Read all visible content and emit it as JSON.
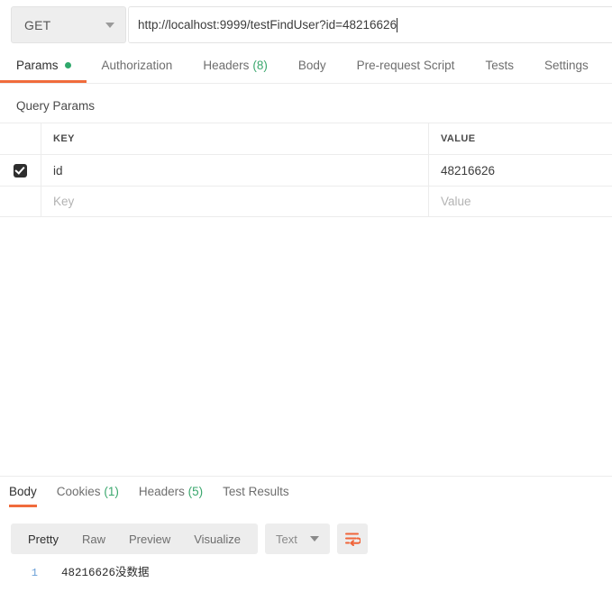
{
  "request": {
    "method": "GET",
    "url": "http://localhost:9999/testFindUser?id=48216626",
    "tabs": [
      {
        "label": "Params",
        "indicator": "dot",
        "active": true
      },
      {
        "label": "Authorization",
        "active": false
      },
      {
        "label": "Headers",
        "count": "(8)",
        "active": false
      },
      {
        "label": "Body",
        "active": false
      },
      {
        "label": "Pre-request Script",
        "active": false
      },
      {
        "label": "Tests",
        "active": false
      },
      {
        "label": "Settings",
        "active": false
      }
    ]
  },
  "query_params": {
    "section_title": "Query Params",
    "columns": {
      "key": "KEY",
      "value": "VALUE"
    },
    "rows": [
      {
        "checked": true,
        "key": "id",
        "value": "48216626"
      },
      {
        "checked": false,
        "key_placeholder": "Key",
        "value_placeholder": "Value"
      }
    ]
  },
  "response": {
    "tabs": [
      {
        "label": "Body",
        "active": true
      },
      {
        "label": "Cookies",
        "count": "(1)",
        "active": false
      },
      {
        "label": "Headers",
        "count": "(5)",
        "active": false
      },
      {
        "label": "Test Results",
        "active": false
      }
    ],
    "viewer_modes": [
      {
        "label": "Pretty",
        "active": true
      },
      {
        "label": "Raw",
        "active": false
      },
      {
        "label": "Preview",
        "active": false
      },
      {
        "label": "Visualize",
        "active": false
      }
    ],
    "format_select": {
      "value": "Text"
    },
    "wrap_button": {
      "icon": "word-wrap-icon"
    },
    "body_lines": [
      {
        "number": "1",
        "text": "48216626没数据"
      }
    ]
  },
  "colors": {
    "accent_orange": "#f06b3c",
    "green": "#3aa76d",
    "toolbar_gray": "#ededed"
  }
}
